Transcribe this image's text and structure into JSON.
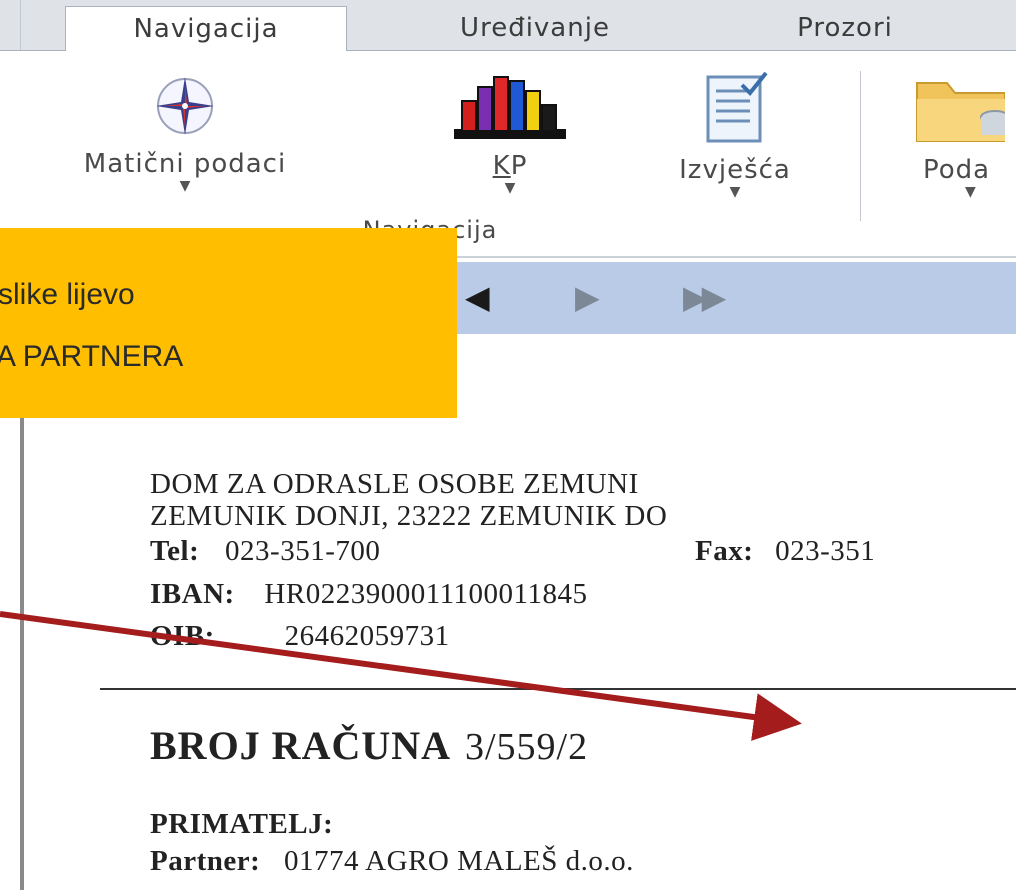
{
  "ribbon": {
    "tabs": [
      {
        "label": "Navigacija"
      },
      {
        "label": "Uređivanje"
      },
      {
        "label": "Prozori"
      }
    ],
    "buttons": [
      {
        "label": "Matični podaci",
        "icon": "compass-icon"
      },
      {
        "label_prefix": "",
        "label_underlined": "K",
        "label_rest": "P",
        "icon": "bar-chart-icon"
      },
      {
        "label": "Izvješća",
        "icon": "report-icon"
      },
      {
        "label": "Poda",
        "icon": "folder-database-icon"
      }
    ],
    "group": {
      "label_underlined": "N",
      "label_rest": "avigacija"
    }
  },
  "nav_strip": {
    "buttons": [
      "◀",
      "▶",
      "▶▶"
    ]
  },
  "callout": {
    "line1": "slike lijevo",
    "line2": "A PARTNERA",
    "color": "#ffbf00"
  },
  "document": {
    "company_line1": "DOM ZA ODRASLE OSOBE   ZEMUNI",
    "company_line2": "ZEMUNIK DONJI, 23222 ZEMUNIK DO",
    "tel_label": "Tel:",
    "tel_value": "023-351-700",
    "fax_label": "Fax:",
    "fax_value": "023-351",
    "iban_label": "IBAN:",
    "iban_value": "HR0223900011100011845",
    "oib_label": "OIB:",
    "oib_value": "26462059731",
    "invoice_title": "BROJ RAČUNA",
    "invoice_number": "3/559/2",
    "recipient_label": "PRIMATELJ:",
    "partner_label": "Partner:",
    "partner_value": "01774  AGRO MALEŠ d.o.o."
  },
  "arrow_color": "#a41c1c"
}
